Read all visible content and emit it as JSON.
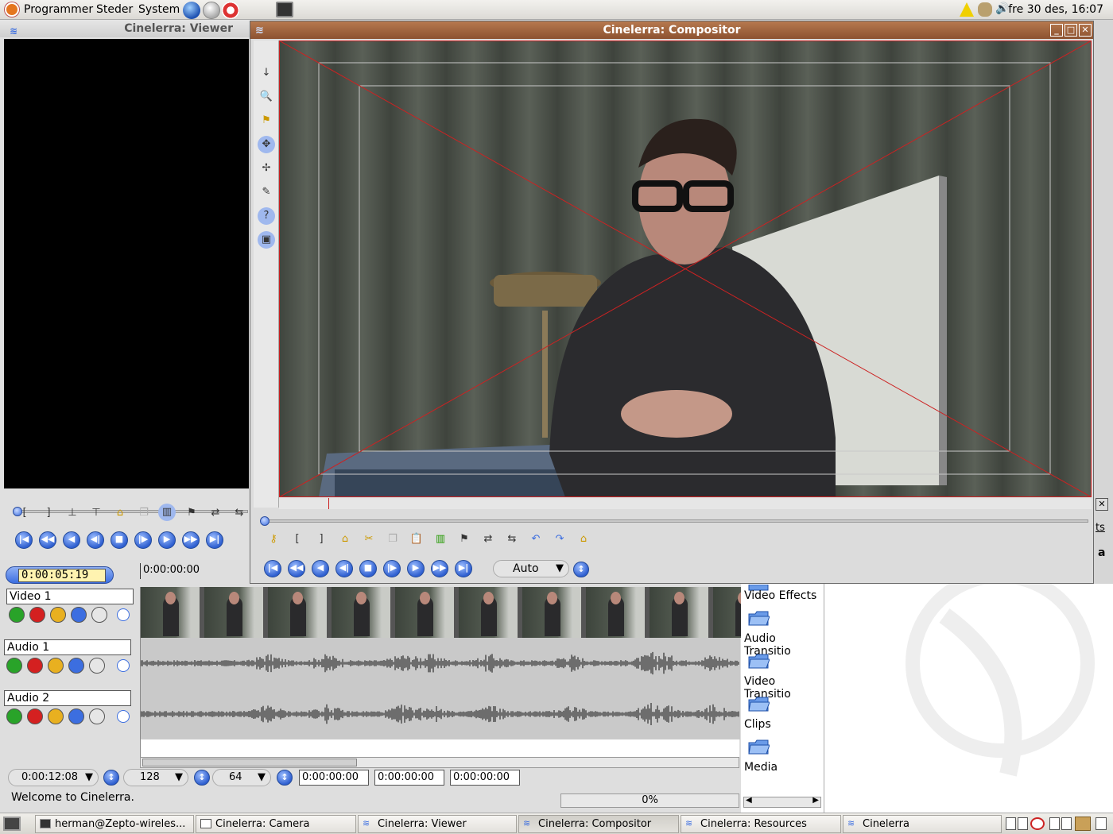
{
  "top_panel": {
    "menus": [
      "Programmer",
      "Steder",
      "System"
    ],
    "clock": "fre 30 des, 16:07"
  },
  "viewer": {
    "title": "Cinelerra: Viewer"
  },
  "compositor": {
    "title": "Cinelerra: Compositor",
    "zoom_value": "Auto"
  },
  "program": {
    "position_timecode": "0:00:05:19",
    "ruler_start": "0:00:00:00",
    "tracks": [
      {
        "name": "Video 1"
      },
      {
        "name": "Audio 1"
      },
      {
        "name": "Audio 2"
      }
    ],
    "zoom_duration": "0:00:12:08",
    "zoom_samples": "128",
    "zoom_amp": "64",
    "selection_start": "0:00:00:00",
    "selection_length": "0:00:00:00",
    "selection_end": "0:00:00:00",
    "status": "Welcome to Cinelerra.",
    "progress_label": "0%",
    "progress": 0
  },
  "resources": {
    "folders": [
      "Video Effects",
      "Audio Transitio",
      "Video Transitio",
      "Clips",
      "Media"
    ],
    "partial_tab": "ts",
    "partial_letter": "a"
  },
  "taskbar": {
    "tasks": [
      {
        "label": "herman@Zepto-wireles..."
      },
      {
        "label": "Cinelerra: Camera"
      },
      {
        "label": "Cinelerra: Viewer"
      },
      {
        "label": "Cinelerra: Compositor"
      },
      {
        "label": "Cinelerra: Resources"
      },
      {
        "label": "Cinelerra"
      }
    ]
  },
  "colors": {
    "accent_blue": "#3c6ee0",
    "titlebar_active": "#8c5230",
    "record_red": "#d42020",
    "play_green": "#29a329",
    "safe_region_red": "#cc2222"
  }
}
